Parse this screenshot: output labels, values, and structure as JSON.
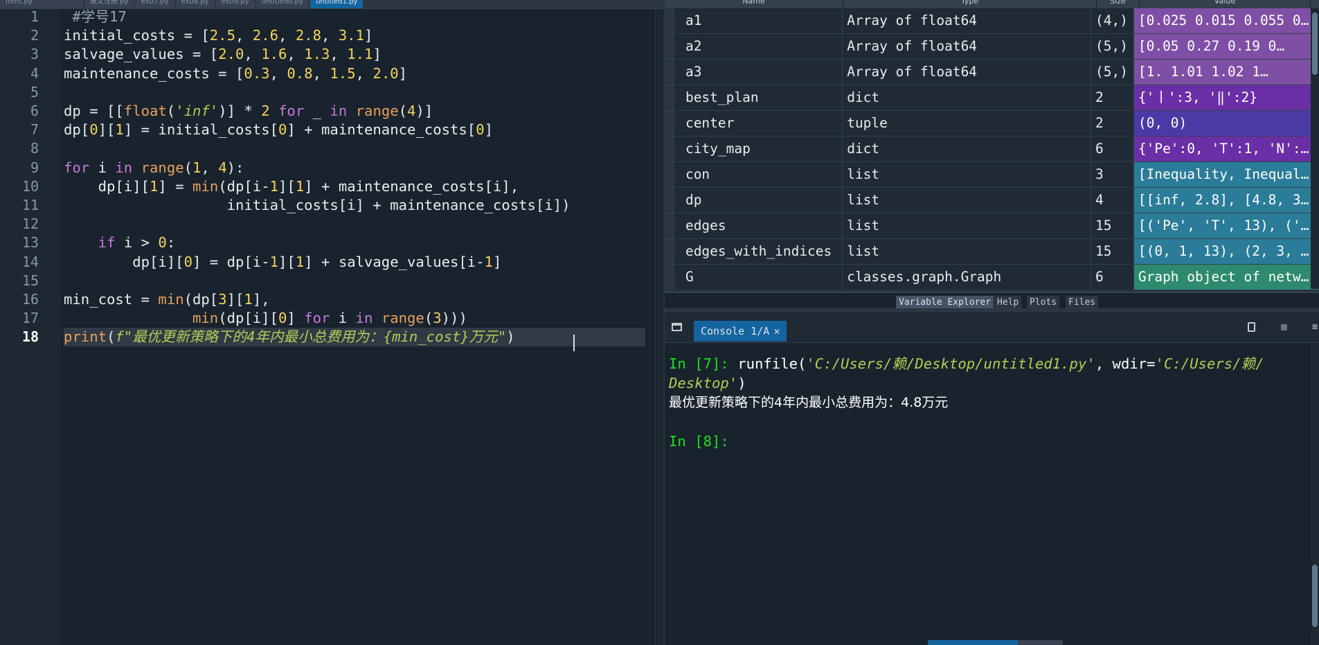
{
  "editor": {
    "tabs": [
      "fomt.py",
      "报文注册.py",
      "ex07.py",
      "ex08.py",
      "ex09.py",
      "untitled0.py",
      "untitled1.py"
    ],
    "active_tab_index": 6,
    "current_line": 18,
    "lines": [
      {
        "n": 1,
        "html": "<span class=\"cmt\"> #学号17</span>"
      },
      {
        "n": 2,
        "html": "initial_costs = [<span class=\"num\">2.5</span>, <span class=\"num\">2.6</span>, <span class=\"num\">2.8</span>, <span class=\"num\">3.1</span>]"
      },
      {
        "n": 3,
        "html": "salvage_values = [<span class=\"num\">2.0</span>, <span class=\"num\">1.6</span>, <span class=\"num\">1.3</span>, <span class=\"num\">1.1</span>]"
      },
      {
        "n": 4,
        "html": "maintenance_costs = [<span class=\"num\">0.3</span>, <span class=\"num\">0.8</span>, <span class=\"num\">1.5</span>, <span class=\"num\">2.0</span>]"
      },
      {
        "n": 5,
        "html": ""
      },
      {
        "n": 6,
        "html": "dp = [[<span class=\"bi\">float</span>(<span class=\"str\">'inf'</span>)] * <span class=\"num\">2</span> <span class=\"kw\">for</span> _ <span class=\"kw\">in</span> <span class=\"bi\">range</span>(<span class=\"num\">4</span>)]"
      },
      {
        "n": 7,
        "html": "dp[<span class=\"num\">0</span>][<span class=\"num\">1</span>] = initial_costs[<span class=\"num\">0</span>] + maintenance_costs[<span class=\"num\">0</span>]"
      },
      {
        "n": 8,
        "html": ""
      },
      {
        "n": 9,
        "html": "<span class=\"kw\">for</span> i <span class=\"kw\">in</span> <span class=\"bi\">range</span>(<span class=\"num\">1</span>, <span class=\"num\">4</span>):"
      },
      {
        "n": 10,
        "html": "    dp[i][<span class=\"num\">1</span>] = <span class=\"bi\">min</span>(dp[i-<span class=\"num\">1</span>][<span class=\"num\">1</span>] + maintenance_costs[i],"
      },
      {
        "n": 11,
        "html": "                   initial_costs[i] + maintenance_costs[i])"
      },
      {
        "n": 12,
        "html": ""
      },
      {
        "n": 13,
        "html": "    <span class=\"kw\">if</span> i &gt; <span class=\"num\">0</span>:"
      },
      {
        "n": 14,
        "html": "        dp[i][<span class=\"num\">0</span>] = dp[i-<span class=\"num\">1</span>][<span class=\"num\">1</span>] + salvage_values[i-<span class=\"num\">1</span>]"
      },
      {
        "n": 15,
        "html": ""
      },
      {
        "n": 16,
        "html": "min_cost = <span class=\"bi\">min</span>(dp[<span class=\"num\">3</span>][<span class=\"num\">1</span>],"
      },
      {
        "n": 17,
        "html": "               <span class=\"bi\">min</span>(dp[i][<span class=\"num\">0</span>] <span class=\"kw\">for</span> i <span class=\"kw\">in</span> <span class=\"bi\">range</span>(<span class=\"num\">3</span>)))"
      },
      {
        "n": 18,
        "html": "<span class=\"bi\">print</span>(<span class=\"str\">f\"最优更新策略下的4年内最小总费用为：{min_cost}万元\"</span>)"
      }
    ]
  },
  "variable_explorer": {
    "headers": {
      "name": "Name",
      "type": "Type",
      "size": "Size",
      "value": "Value"
    },
    "rows": [
      {
        "name": "a1",
        "type": "Array of float64",
        "size": "(4,)",
        "value": "[0.025 0.015 0.055 0…",
        "color": "#7f4fa6"
      },
      {
        "name": "a2",
        "type": "Array of float64",
        "size": "(5,)",
        "value": "[0.05  0.27  0.19  0…",
        "color": "#7f4fa6"
      },
      {
        "name": "a3",
        "type": "Array of float64",
        "size": "(5,)",
        "value": "[1.    1.01  1.02  1…",
        "color": "#7f4fa6"
      },
      {
        "name": "best_plan",
        "type": "dict",
        "size": "2",
        "value": "{'丨':3, '‖':2}",
        "color": "#6a2fa6"
      },
      {
        "name": "center",
        "type": "tuple",
        "size": "2",
        "value": "(0, 0)",
        "color": "#4a3aa6"
      },
      {
        "name": "city_map",
        "type": "dict",
        "size": "6",
        "value": "{'Pe':0, 'T':1, 'N':…",
        "color": "#6a2fa6"
      },
      {
        "name": "con",
        "type": "list",
        "size": "3",
        "value": "[Inequality, Inequal…",
        "color": "#2b7c99"
      },
      {
        "name": "dp",
        "type": "list",
        "size": "4",
        "value": "[[inf, 2.8], [4.8, 3…",
        "color": "#2b7c99"
      },
      {
        "name": "edges",
        "type": "list",
        "size": "15",
        "value": "[('Pe', 'T', 13), ('…",
        "color": "#2b7c99"
      },
      {
        "name": "edges_with_indices",
        "type": "list",
        "size": "15",
        "value": "[(0, 1, 13), (2, 3, …",
        "color": "#2b7c99"
      },
      {
        "name": "G",
        "type": "classes.graph.Graph",
        "size": "6",
        "value": "Graph object of netw…",
        "color": "#2e8a6e"
      }
    ],
    "pane_tabs": [
      "Variable Explorer",
      "Help",
      "Plots",
      "Files"
    ]
  },
  "console": {
    "tab_label": "Console 1/A",
    "close_symbol": "✕",
    "prompt1": "In [7]:",
    "cmd_pre": " runfile(",
    "cmd_str1": "'C:/Users/赖/Desktop/untitled1.py'",
    "cmd_mid": ", wdir=",
    "cmd_str2a": "'C:/Users/赖/",
    "cmd_str2b": "Desktop'",
    "cmd_end": ")",
    "output": "最优更新策略下的4年内最小总费用为：4.8万元",
    "prompt2": "In [8]:",
    "menu_symbol": "≡"
  }
}
